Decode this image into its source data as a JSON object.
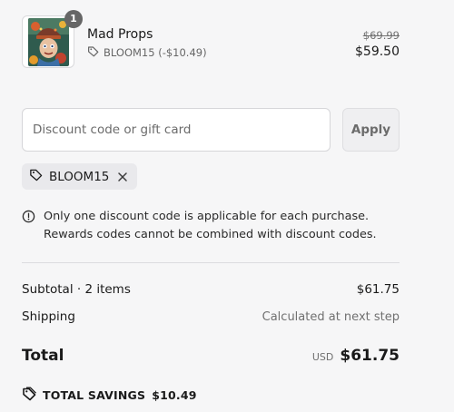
{
  "line_item": {
    "quantity": "1",
    "name": "Mad Props",
    "discount_label": "BLOOM15 (-$10.49)",
    "original_price": "$69.99",
    "price": "$59.50",
    "thumbnail_icon": "product-artwork-thumbnail"
  },
  "discount": {
    "placeholder": "Discount code or gift card",
    "value": "",
    "apply_label": "Apply",
    "applied_code": "BLOOM15",
    "tag_icon": "tag-icon",
    "remove_icon": "close-icon"
  },
  "notice": {
    "icon": "info-icon",
    "line1": "Only one discount code is applicable for each purchase.",
    "line2": "Rewards codes cannot be combined with discount codes."
  },
  "summary": {
    "subtotal_label": "Subtotal · 2 items",
    "subtotal_value": "$61.75",
    "shipping_label": "Shipping",
    "shipping_value": "Calculated at next step",
    "total_label": "Total",
    "currency": "USD",
    "total_value": "$61.75",
    "savings_label": "TOTAL SAVINGS",
    "savings_value": "$10.49"
  },
  "colors": {
    "background": "#f6f6f7",
    "text": "#1a1a1a",
    "muted": "#707070",
    "badge": "#666666",
    "chip": "#e9e9ec"
  }
}
